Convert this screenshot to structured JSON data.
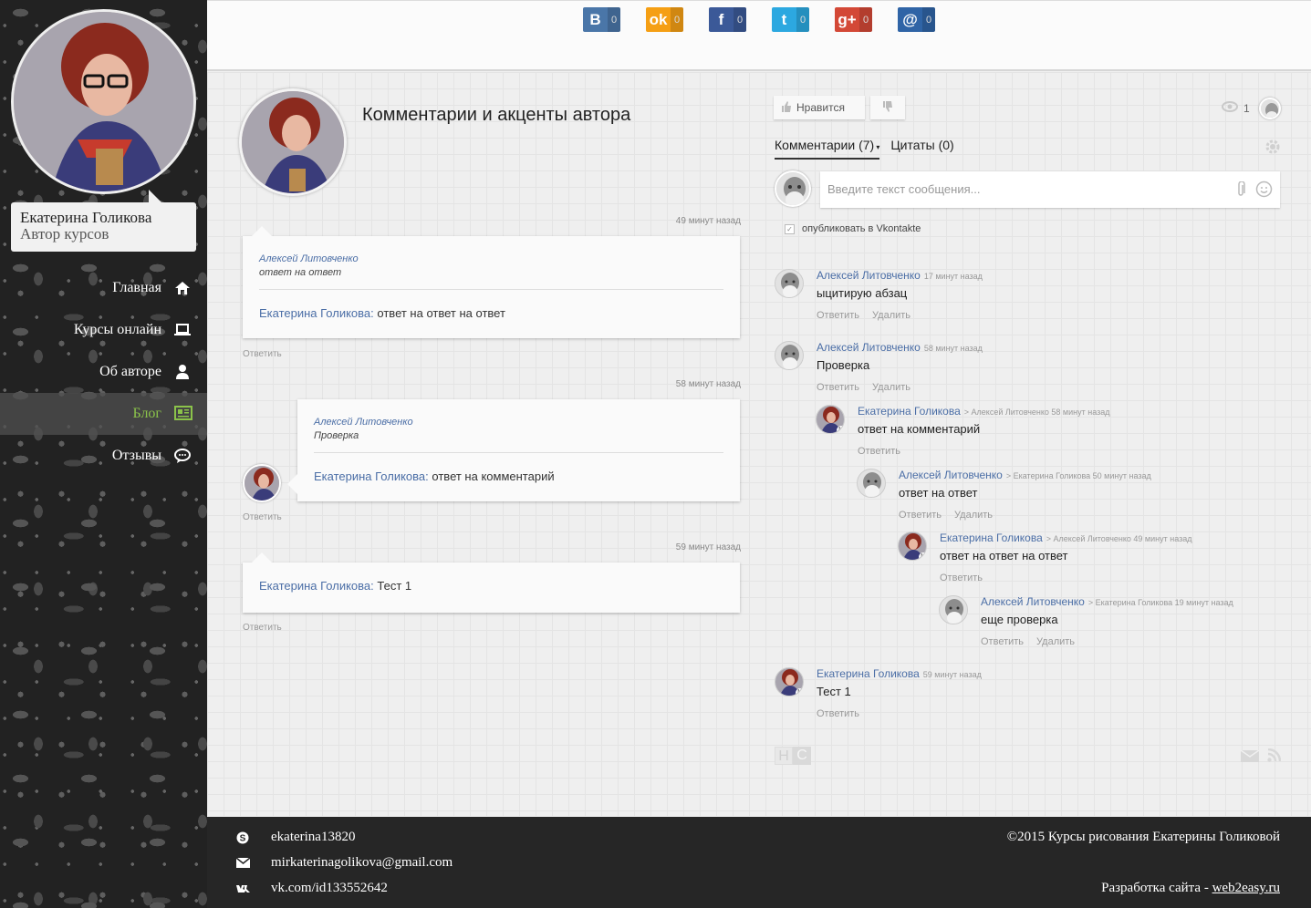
{
  "sidebar": {
    "name": "Екатерина Голикова",
    "role": "Автор курсов",
    "nav": [
      {
        "label": "Главная",
        "icon": "home-icon"
      },
      {
        "label": "Курсы онлайн",
        "icon": "laptop-icon"
      },
      {
        "label": "Об авторе",
        "icon": "user-icon"
      },
      {
        "label": "Блог",
        "icon": "newspaper-icon",
        "active": true
      },
      {
        "label": "Отзывы",
        "icon": "chat-icon"
      }
    ]
  },
  "share": [
    {
      "icon": "vk-icon",
      "glyph": "B",
      "count": "0",
      "color": "#4a76a8"
    },
    {
      "icon": "odnoklassniki-icon",
      "glyph": "ok",
      "count": "0",
      "color": "#f59f14"
    },
    {
      "icon": "facebook-icon",
      "glyph": "f",
      "count": "0",
      "color": "#3b5998"
    },
    {
      "icon": "twitter-icon",
      "glyph": "t",
      "count": "0",
      "color": "#2ca8e0"
    },
    {
      "icon": "google-plus-icon",
      "glyph": "g+",
      "count": "0",
      "color": "#d34836"
    },
    {
      "icon": "mail-icon",
      "glyph": "@",
      "count": "0",
      "color": "#2f64a6"
    }
  ],
  "post": {
    "title": "Комментарии и акценты автора"
  },
  "left_cards": [
    {
      "time": "49 минут назад",
      "quote_user": "Алексей Литовченко",
      "quote_text": "ответ на ответ",
      "user": "Екатерина Голикова:",
      "text": "ответ на ответ на ответ",
      "reply": "Ответить"
    },
    {
      "time": "58 минут назад",
      "quote_user": "Алексей Литовченко",
      "quote_text": "Проверка",
      "user": "Екатерина Голикова:",
      "text": "ответ на комментарий",
      "reply": "Ответить"
    },
    {
      "time": "59 минут назад",
      "user": "Екатерина Голикова:",
      "text": "Тест 1",
      "reply": "Ответить"
    }
  ],
  "widget": {
    "like": "Нравится",
    "views": "1",
    "tab_comments": "Комментарии (7)",
    "tab_quotes": "Цитаты (0)",
    "input_placeholder": "Введите текст сообщения...",
    "publish_label": "опубликовать в Vkontakte",
    "reply": "Ответить",
    "delete": "Удалить"
  },
  "comments": [
    {
      "user": "Алексей Литовченко",
      "meta": "17 минут назад",
      "text": "ыцитирую абзац",
      "del": true,
      "av": "old"
    },
    {
      "user": "Алексей Литовченко",
      "meta": "58 минут назад",
      "text": "Проверка",
      "del": true,
      "av": "old"
    },
    {
      "user": "Екатерина Голикова",
      "meta": "> Алексей Литовченко  58 минут назад",
      "text": "ответ на комментарий",
      "del": false,
      "av": "kat"
    },
    {
      "user": "Алексей Литовченко",
      "meta": "> Екатерина Голикова  50 минут назад",
      "text": "ответ на ответ",
      "del": true,
      "av": "old"
    },
    {
      "user": "Екатерина Голикова",
      "meta": "> Алексей Литовченко  49 минут назад",
      "text": "ответ на ответ на ответ",
      "del": false,
      "av": "kat"
    },
    {
      "user": "Алексей Литовченко",
      "meta": "> Екатерина Голикова  19 минут назад",
      "text": "еще проверка",
      "del": true,
      "av": "old"
    },
    {
      "user": "Екатерина Голикова",
      "meta": "59 минут назад",
      "text": "Тест 1",
      "del": false,
      "av": "kat"
    }
  ],
  "hc_logo": "HC",
  "footer": {
    "skype": "ekaterina13820",
    "email": "mirkaterinagolikova@gmail.com",
    "vk": "vk.com/id133552642",
    "copyright": "©2015 Курсы рисования Екатерины Голиковой",
    "dev_prefix": "Разработка сайта - ",
    "dev_link": "web2easy.ru"
  }
}
